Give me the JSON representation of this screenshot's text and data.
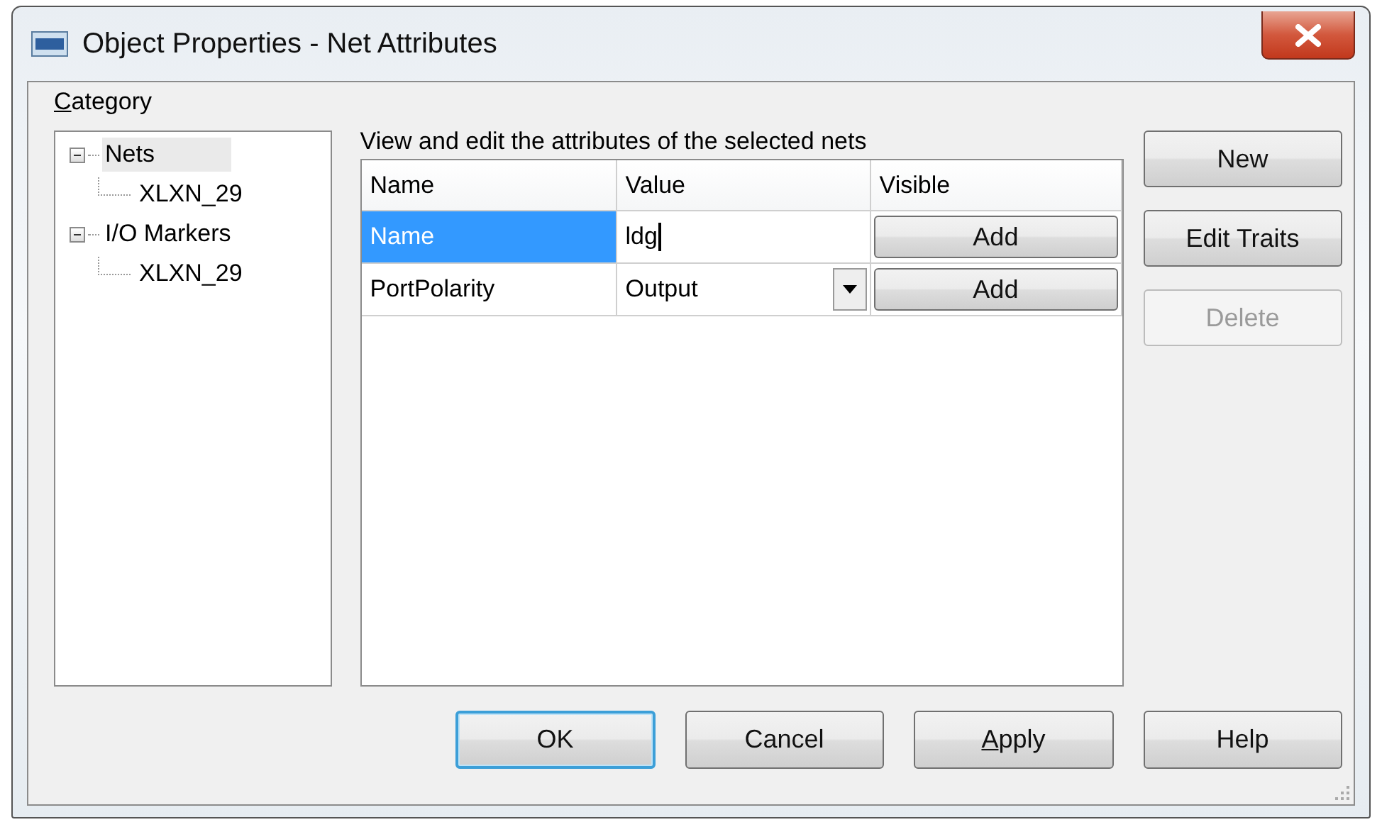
{
  "window": {
    "title": "Object Properties - Net Attributes"
  },
  "category": {
    "label": "Category",
    "mnemonic_underlined": true
  },
  "tree": [
    {
      "label": "Nets",
      "expanded": true,
      "selected": true,
      "children": [
        {
          "label": "XLXN_29",
          "selected": false
        }
      ]
    },
    {
      "label": "I/O Markers",
      "expanded": true,
      "selected": false,
      "children": [
        {
          "label": "XLXN_29",
          "selected": false
        }
      ]
    }
  ],
  "table": {
    "caption": "View and edit the attributes of the selected nets",
    "columns": [
      "Name",
      "Value",
      "Visible"
    ],
    "rows": [
      {
        "name": "Name",
        "selected": true,
        "kind": "text",
        "value": "ldg",
        "focused": true,
        "visible_button": "Add"
      },
      {
        "name": "PortPolarity",
        "selected": false,
        "kind": "dropdown",
        "value": "Output",
        "focused": false,
        "visible_button": "Add"
      }
    ]
  },
  "side_buttons": [
    {
      "label": "New",
      "disabled": false
    },
    {
      "label": "Edit Traits",
      "disabled": false
    },
    {
      "label": "Delete",
      "disabled": true
    }
  ],
  "footer_buttons": [
    {
      "label": "OK",
      "default": true,
      "mnemonic_underlined": false
    },
    {
      "label": "Cancel",
      "default": false,
      "mnemonic_underlined": false
    },
    {
      "label": "Apply",
      "default": false,
      "mnemonic_underlined": true
    },
    {
      "label": "Help",
      "default": false,
      "mnemonic_underlined": false
    }
  ]
}
